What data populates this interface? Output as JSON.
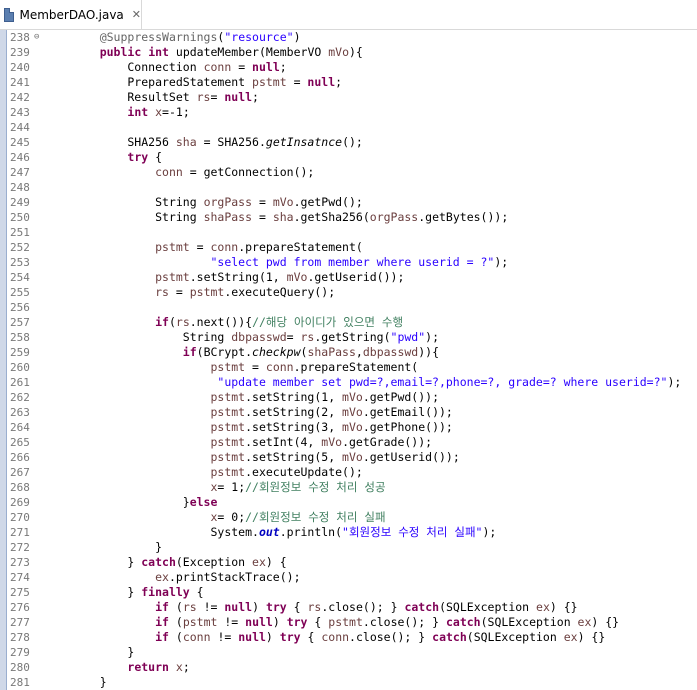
{
  "tab": {
    "title": "MemberDAO.java",
    "close_glyph": "✕"
  },
  "colors": {
    "keyword": "#7f0055",
    "string": "#2a00ff",
    "comment": "#3f7f5f",
    "annotation": "#646464",
    "local_variable": "#6a3e3e",
    "static_field": "#0000c0"
  },
  "lines": [
    {
      "n": "238",
      "fold": "⊖",
      "t": [
        [
          "    ",
          ""
        ],
        [
          "@SuppressWarnings",
          "ann"
        ],
        [
          "(",
          ""
        ],
        [
          "\"resource\"",
          "str"
        ],
        [
          ")",
          ""
        ]
      ]
    },
    {
      "n": "239",
      "t": [
        [
          "    ",
          ""
        ],
        [
          "public",
          "kw"
        ],
        [
          " ",
          ""
        ],
        [
          "int",
          "kw"
        ],
        [
          " updateMember(MemberVO ",
          ""
        ],
        [
          "mVo",
          "var"
        ],
        [
          "){",
          ""
        ]
      ]
    },
    {
      "n": "240",
      "t": [
        [
          "        Connection ",
          ""
        ],
        [
          "conn",
          "var"
        ],
        [
          " = ",
          ""
        ],
        [
          "null",
          "kw"
        ],
        [
          ";",
          ""
        ]
      ]
    },
    {
      "n": "241",
      "t": [
        [
          "        PreparedStatement ",
          ""
        ],
        [
          "pstmt",
          "var"
        ],
        [
          " = ",
          ""
        ],
        [
          "null",
          "kw"
        ],
        [
          ";",
          ""
        ]
      ]
    },
    {
      "n": "242",
      "t": [
        [
          "        ResultSet ",
          ""
        ],
        [
          "rs",
          "var"
        ],
        [
          "= ",
          ""
        ],
        [
          "null",
          "kw"
        ],
        [
          ";",
          ""
        ]
      ]
    },
    {
      "n": "243",
      "t": [
        [
          "        ",
          ""
        ],
        [
          "int",
          "kw"
        ],
        [
          " ",
          ""
        ],
        [
          "x",
          "var"
        ],
        [
          "=-1;",
          ""
        ]
      ]
    },
    {
      "n": "244",
      "t": []
    },
    {
      "n": "245",
      "t": [
        [
          "        SHA256 ",
          ""
        ],
        [
          "sha",
          "var"
        ],
        [
          " = SHA256.",
          ""
        ],
        [
          "getInsatnce",
          "it"
        ],
        [
          "();",
          ""
        ]
      ]
    },
    {
      "n": "246",
      "t": [
        [
          "        ",
          ""
        ],
        [
          "try",
          "kw"
        ],
        [
          " {",
          ""
        ]
      ]
    },
    {
      "n": "247",
      "t": [
        [
          "            ",
          ""
        ],
        [
          "conn",
          "var"
        ],
        [
          " = getConnection();",
          ""
        ]
      ]
    },
    {
      "n": "248",
      "t": []
    },
    {
      "n": "249",
      "t": [
        [
          "            String ",
          ""
        ],
        [
          "orgPass",
          "var"
        ],
        [
          " = ",
          ""
        ],
        [
          "mVo",
          "var"
        ],
        [
          ".getPwd();",
          ""
        ]
      ]
    },
    {
      "n": "250",
      "t": [
        [
          "            String ",
          ""
        ],
        [
          "shaPass",
          "var"
        ],
        [
          " = ",
          ""
        ],
        [
          "sha",
          "var"
        ],
        [
          ".getSha256(",
          ""
        ],
        [
          "orgPass",
          "var"
        ],
        [
          ".getBytes());",
          ""
        ]
      ]
    },
    {
      "n": "251",
      "t": []
    },
    {
      "n": "252",
      "t": [
        [
          "            ",
          ""
        ],
        [
          "pstmt",
          "var"
        ],
        [
          " = ",
          ""
        ],
        [
          "conn",
          "var"
        ],
        [
          ".prepareStatement(",
          ""
        ]
      ]
    },
    {
      "n": "253",
      "t": [
        [
          "                    ",
          ""
        ],
        [
          "\"select pwd from member where userid = ?\"",
          "str"
        ],
        [
          ");",
          ""
        ]
      ]
    },
    {
      "n": "254",
      "t": [
        [
          "            ",
          ""
        ],
        [
          "pstmt",
          "var"
        ],
        [
          ".setString(1, ",
          ""
        ],
        [
          "mVo",
          "var"
        ],
        [
          ".getUserid());",
          ""
        ]
      ]
    },
    {
      "n": "255",
      "t": [
        [
          "            ",
          ""
        ],
        [
          "rs",
          "var"
        ],
        [
          " = ",
          ""
        ],
        [
          "pstmt",
          "var"
        ],
        [
          ".executeQuery();",
          ""
        ]
      ]
    },
    {
      "n": "256",
      "t": []
    },
    {
      "n": "257",
      "t": [
        [
          "            ",
          ""
        ],
        [
          "if",
          "kw"
        ],
        [
          "(",
          ""
        ],
        [
          "rs",
          "var"
        ],
        [
          ".next()){",
          ""
        ],
        [
          "//해당 아이디가 있으면 수행",
          "cm"
        ]
      ]
    },
    {
      "n": "258",
      "t": [
        [
          "                String ",
          ""
        ],
        [
          "dbpasswd",
          "var"
        ],
        [
          "= ",
          ""
        ],
        [
          "rs",
          "var"
        ],
        [
          ".getString(",
          ""
        ],
        [
          "\"pwd\"",
          "str"
        ],
        [
          ");",
          ""
        ]
      ]
    },
    {
      "n": "259",
      "t": [
        [
          "                ",
          ""
        ],
        [
          "if",
          "kw"
        ],
        [
          "(BCrypt.",
          ""
        ],
        [
          "checkpw",
          "it"
        ],
        [
          "(",
          ""
        ],
        [
          "shaPass",
          "var"
        ],
        [
          ",",
          ""
        ],
        [
          "dbpasswd",
          "var"
        ],
        [
          ")){",
          ""
        ]
      ]
    },
    {
      "n": "260",
      "t": [
        [
          "                    ",
          ""
        ],
        [
          "pstmt",
          "var"
        ],
        [
          " = ",
          ""
        ],
        [
          "conn",
          "var"
        ],
        [
          ".prepareStatement(",
          ""
        ]
      ]
    },
    {
      "n": "261",
      "t": [
        [
          "                     ",
          ""
        ],
        [
          "\"update member set pwd=?,email=?,phone=?, grade=? where userid=?\"",
          "str"
        ],
        [
          ");",
          ""
        ]
      ]
    },
    {
      "n": "262",
      "t": [
        [
          "                    ",
          ""
        ],
        [
          "pstmt",
          "var"
        ],
        [
          ".setString(1, ",
          ""
        ],
        [
          "mVo",
          "var"
        ],
        [
          ".getPwd());",
          ""
        ]
      ]
    },
    {
      "n": "263",
      "t": [
        [
          "                    ",
          ""
        ],
        [
          "pstmt",
          "var"
        ],
        [
          ".setString(2, ",
          ""
        ],
        [
          "mVo",
          "var"
        ],
        [
          ".getEmail());",
          ""
        ]
      ]
    },
    {
      "n": "264",
      "t": [
        [
          "                    ",
          ""
        ],
        [
          "pstmt",
          "var"
        ],
        [
          ".setString(3, ",
          ""
        ],
        [
          "mVo",
          "var"
        ],
        [
          ".getPhone());",
          ""
        ]
      ]
    },
    {
      "n": "265",
      "t": [
        [
          "                    ",
          ""
        ],
        [
          "pstmt",
          "var"
        ],
        [
          ".setInt(4, ",
          ""
        ],
        [
          "mVo",
          "var"
        ],
        [
          ".getGrade());",
          ""
        ]
      ]
    },
    {
      "n": "266",
      "t": [
        [
          "                    ",
          ""
        ],
        [
          "pstmt",
          "var"
        ],
        [
          ".setString(5, ",
          ""
        ],
        [
          "mVo",
          "var"
        ],
        [
          ".getUserid());",
          ""
        ]
      ]
    },
    {
      "n": "267",
      "t": [
        [
          "                    ",
          ""
        ],
        [
          "pstmt",
          "var"
        ],
        [
          ".executeUpdate();",
          ""
        ]
      ]
    },
    {
      "n": "268",
      "t": [
        [
          "                    ",
          ""
        ],
        [
          "x",
          "var"
        ],
        [
          "= 1;",
          ""
        ],
        [
          "//회원정보 수정 처리 성공",
          "cm"
        ]
      ]
    },
    {
      "n": "269",
      "t": [
        [
          "                }",
          ""
        ],
        [
          "else",
          "kw"
        ]
      ]
    },
    {
      "n": "270",
      "t": [
        [
          "                    ",
          ""
        ],
        [
          "x",
          "var"
        ],
        [
          "= 0;",
          ""
        ],
        [
          "//회원정보 수정 처리 실패",
          "cm"
        ]
      ]
    },
    {
      "n": "271",
      "t": [
        [
          "                    System.",
          ""
        ],
        [
          "out",
          "fld"
        ],
        [
          ".println(",
          ""
        ],
        [
          "\"회원정보 수정 처리 실패\"",
          "str"
        ],
        [
          ");",
          ""
        ]
      ]
    },
    {
      "n": "272",
      "t": [
        [
          "            }",
          ""
        ]
      ]
    },
    {
      "n": "273",
      "t": [
        [
          "        } ",
          ""
        ],
        [
          "catch",
          "kw"
        ],
        [
          "(Exception ",
          ""
        ],
        [
          "ex",
          "var"
        ],
        [
          ") {",
          ""
        ]
      ]
    },
    {
      "n": "274",
      "t": [
        [
          "            ",
          ""
        ],
        [
          "ex",
          "var"
        ],
        [
          ".printStackTrace();",
          ""
        ]
      ]
    },
    {
      "n": "275",
      "t": [
        [
          "        } ",
          ""
        ],
        [
          "finally",
          "kw"
        ],
        [
          " {",
          ""
        ]
      ]
    },
    {
      "n": "276",
      "t": [
        [
          "            ",
          ""
        ],
        [
          "if",
          "kw"
        ],
        [
          " (",
          ""
        ],
        [
          "rs",
          "var"
        ],
        [
          " != ",
          ""
        ],
        [
          "null",
          "kw"
        ],
        [
          ") ",
          ""
        ],
        [
          "try",
          "kw"
        ],
        [
          " { ",
          ""
        ],
        [
          "rs",
          "var"
        ],
        [
          ".close(); } ",
          ""
        ],
        [
          "catch",
          "kw"
        ],
        [
          "(SQLException ",
          ""
        ],
        [
          "ex",
          "var"
        ],
        [
          ") {}",
          ""
        ]
      ]
    },
    {
      "n": "277",
      "t": [
        [
          "            ",
          ""
        ],
        [
          "if",
          "kw"
        ],
        [
          " (",
          ""
        ],
        [
          "pstmt",
          "var"
        ],
        [
          " != ",
          ""
        ],
        [
          "null",
          "kw"
        ],
        [
          ") ",
          ""
        ],
        [
          "try",
          "kw"
        ],
        [
          " { ",
          ""
        ],
        [
          "pstmt",
          "var"
        ],
        [
          ".close(); } ",
          ""
        ],
        [
          "catch",
          "kw"
        ],
        [
          "(SQLException ",
          ""
        ],
        [
          "ex",
          "var"
        ],
        [
          ") {}",
          ""
        ]
      ]
    },
    {
      "n": "278",
      "t": [
        [
          "            ",
          ""
        ],
        [
          "if",
          "kw"
        ],
        [
          " (",
          ""
        ],
        [
          "conn",
          "var"
        ],
        [
          " != ",
          ""
        ],
        [
          "null",
          "kw"
        ],
        [
          ") ",
          ""
        ],
        [
          "try",
          "kw"
        ],
        [
          " { ",
          ""
        ],
        [
          "conn",
          "var"
        ],
        [
          ".close(); } ",
          ""
        ],
        [
          "catch",
          "kw"
        ],
        [
          "(SQLException ",
          ""
        ],
        [
          "ex",
          "var"
        ],
        [
          ") {}",
          ""
        ]
      ]
    },
    {
      "n": "279",
      "t": [
        [
          "        }",
          ""
        ]
      ]
    },
    {
      "n": "280",
      "t": [
        [
          "        ",
          ""
        ],
        [
          "return",
          "kw"
        ],
        [
          " ",
          ""
        ],
        [
          "x",
          "var"
        ],
        [
          ";",
          ""
        ]
      ]
    },
    {
      "n": "281",
      "t": [
        [
          "    }",
          ""
        ]
      ]
    }
  ]
}
